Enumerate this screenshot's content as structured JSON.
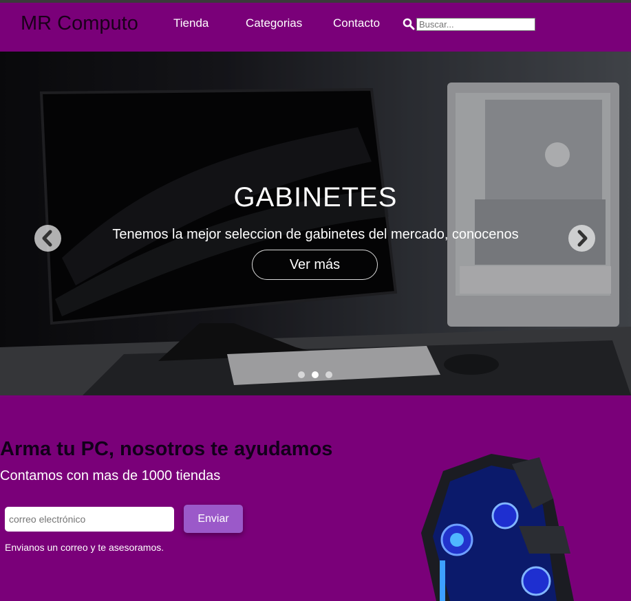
{
  "navbar": {
    "brand": "MR Computo",
    "links": [
      "Tienda",
      "Categorias",
      "Contacto"
    ],
    "search_placeholder": "Buscar..."
  },
  "hero": {
    "title": "GABINETES",
    "subtitle": "Tenemos la mejor seleccion de gabinetes del mercado, conocenos",
    "button_label": "Ver más",
    "slide_count": 3,
    "active_slide": 2
  },
  "promo": {
    "title": "Arma tu PC, nosotros te ayudamos",
    "subtitle": "Contamos con mas de 1000 tiendas",
    "email_placeholder": "correo electrónico",
    "send_label": "Enviar",
    "note": "Envianos un correo y te asesoramos."
  },
  "colors": {
    "brand_purple": "#7a0079",
    "button_purple": "#9b59c9",
    "text_dark": "#12001a",
    "text_light": "#ffffff"
  },
  "icons": {
    "search": "magnifier-icon",
    "prev": "chevron-left-icon",
    "next": "chevron-right-icon"
  }
}
